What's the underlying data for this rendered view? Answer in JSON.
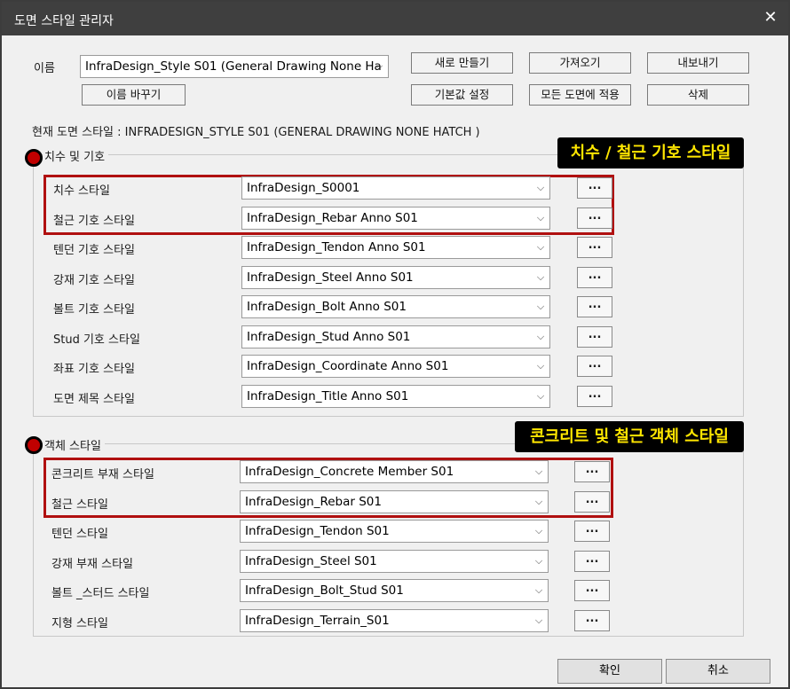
{
  "window": {
    "title": "도면 스타일 관리자",
    "close_glyph": "✕"
  },
  "name_label": "이름",
  "name_value": "InfraDesign_Style S01 (General Drawing None Ha",
  "buttons": {
    "new": "새로 만들기",
    "import": "가져오기",
    "export": "내보내기",
    "rename": "이름 바꾸기",
    "set_default": "기본값 설정",
    "apply_all": "모든 도면에 적용",
    "delete": "삭제"
  },
  "current_style": "현재 도면 스타일 : INFRADESIGN_STYLE S01 (GENERAL DRAWING NONE HATCH )",
  "group1": {
    "title": "치수 및 기호",
    "callout": "치수 / 철근 기호 스타일",
    "rows": [
      {
        "label": "치수 스타일",
        "value": "InfraDesign_S0001"
      },
      {
        "label": "철근 기호 스타일",
        "value": "InfraDesign_Rebar Anno S01"
      },
      {
        "label": "텐던 기호 스타일",
        "value": "InfraDesign_Tendon Anno S01"
      },
      {
        "label": "강재 기호 스타일",
        "value": "InfraDesign_Steel Anno S01"
      },
      {
        "label": "볼트 기호 스타일",
        "value": "InfraDesign_Bolt Anno S01"
      },
      {
        "label": "Stud 기호 스타일",
        "value": "InfraDesign_Stud Anno S01"
      },
      {
        "label": "좌표 기호 스타일",
        "value": "InfraDesign_Coordinate Anno S01"
      },
      {
        "label": "도면 제목 스타일",
        "value": "InfraDesign_Title Anno S01"
      }
    ]
  },
  "group2": {
    "title": "객체 스타일",
    "callout": "콘크리트 및 철근 객체 스타일",
    "rows": [
      {
        "label": "콘크리트 부재 스타일",
        "value": "InfraDesign_Concrete Member S01"
      },
      {
        "label": "철근 스타일",
        "value": "InfraDesign_Rebar S01"
      },
      {
        "label": "텐던 스타일",
        "value": "InfraDesign_Tendon S01"
      },
      {
        "label": "강재 부재 스타일",
        "value": "InfraDesign_Steel S01"
      },
      {
        "label": "볼트 _스터드 스타일",
        "value": "InfraDesign_Bolt_Stud S01"
      },
      {
        "label": "지형 스타일",
        "value": "InfraDesign_Terrain_S01"
      }
    ]
  },
  "ellipsis": "...",
  "chevron": "⌵",
  "footer": {
    "ok": "확인",
    "cancel": "취소"
  },
  "colors": {
    "titlebar": "#3f3f3f",
    "highlight": "#b01010",
    "callout_bg": "#000000",
    "callout_text": "#ffe600",
    "marker": "#c00000"
  }
}
